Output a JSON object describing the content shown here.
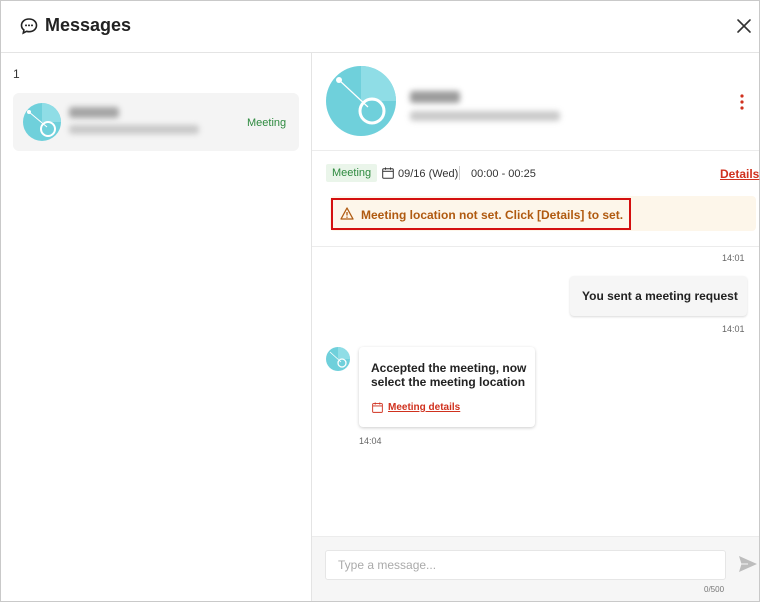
{
  "header": {
    "title": "Messages",
    "icon": "chat-bubble-icon",
    "close_icon": "close-icon"
  },
  "sidebar": {
    "count": "1",
    "conversation": {
      "tag": "Meeting"
    }
  },
  "meeting": {
    "tag": "Meeting",
    "date": "09/16 (Wed)",
    "time": "00:00 - 00:25",
    "details_link": "Details",
    "warning": "Meeting location not set. Click [Details] to set."
  },
  "messages": {
    "ts_top": "14:01",
    "outgoing": {
      "text": "You sent a meeting request",
      "time": "14:01"
    },
    "incoming": {
      "line1": "Accepted the meeting, now",
      "line2": "select the meeting location",
      "link": "Meeting details",
      "time": "14:04"
    }
  },
  "composer": {
    "placeholder": "Type a message...",
    "counter": "0/500"
  },
  "colors": {
    "accent_red": "#d0311e",
    "meeting_green": "#2e8a3f",
    "warning_text": "#b05a10",
    "warning_bg": "#fdf6ea",
    "avatar_teal": "#6fd0db"
  }
}
